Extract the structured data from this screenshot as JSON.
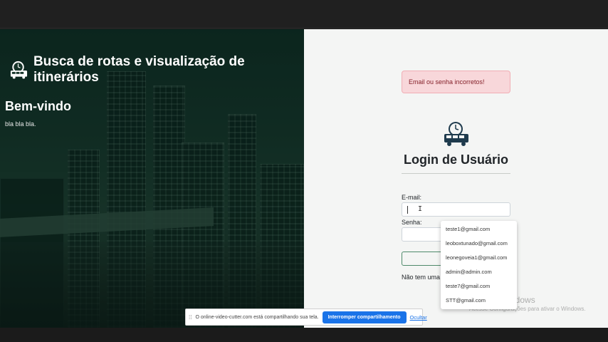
{
  "left_panel": {
    "brand_title": "Busca de rotas e visualização de itinerários",
    "welcome_heading": "Bem-vindo",
    "welcome_text": "bla bla bla."
  },
  "login": {
    "alert_text": "Email ou senha incorretos!",
    "title": "Login de Usuário",
    "email_label": "E-mail:",
    "email_value": "",
    "password_label": "Senha:",
    "password_value": "",
    "no_account_text": "Não tem uma"
  },
  "autocomplete": {
    "items": [
      "teste1@gmail.com",
      "leoboxtunado@gmail.com",
      "leonegoveia1@gmail.com",
      "admin@admin.com",
      "teste7@gmail.com",
      "STT@gmail.com"
    ]
  },
  "windows_watermark": {
    "title": "Ativar o Windows",
    "subtitle": "Acesse Configurações para ativar o Windows."
  },
  "share_bar": {
    "message": "O online-video-cutter.com está compartilhando sua tela.",
    "stop_label": "Interromper compartilhamento",
    "hide_label": "Ocultar"
  },
  "colors": {
    "alert_bg": "#f8d7da",
    "alert_text": "#842029",
    "share_button": "#1a73e8",
    "left_panel_bg": "#163429"
  },
  "icons": {
    "brand_logo": "clock-bus-icon",
    "login_logo": "clock-bus-icon",
    "cursor": "text-cursor-icon"
  }
}
